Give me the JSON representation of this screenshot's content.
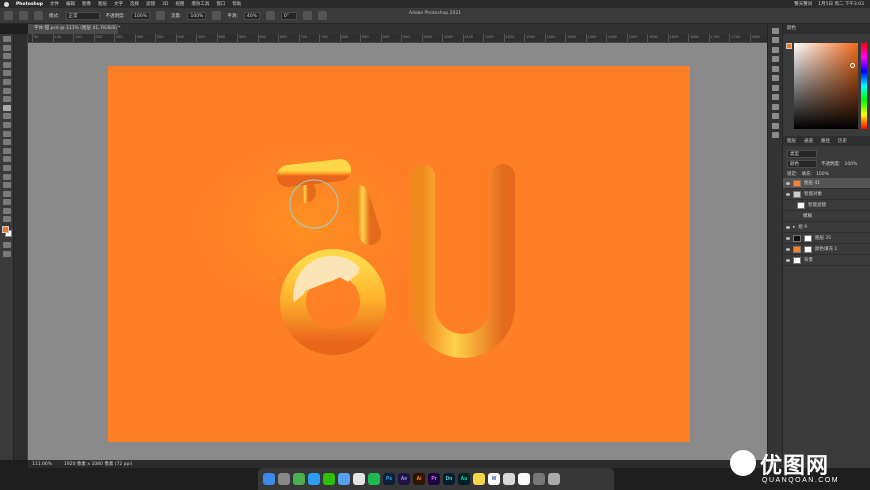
{
  "menubar": {
    "app_name": "Photoshop",
    "items": [
      "文件",
      "编辑",
      "图像",
      "图层",
      "文字",
      "选择",
      "滤镜",
      "3D",
      "视图",
      "增效工具",
      "窗口",
      "帮助"
    ],
    "right_items": [
      "蟹天蟹间",
      "1月5日 周二 下午3:03"
    ]
  },
  "options_bar": {
    "window_title": "Adobe Photoshop 2021",
    "mode_label": "模式:",
    "mode_value": "正常",
    "opacity_label": "不透明度:",
    "opacity_value": "100%",
    "flow_label": "流量:",
    "flow_value": "100%",
    "smoothing_label": "平滑:",
    "smoothing_value": "40%",
    "angle_value": "0°"
  },
  "document": {
    "tab_label": "字体-甜.psd @ 111% (图层 41, RGB/8) *",
    "status_zoom": "111.06%",
    "status_doc": "1920 像素 x 1080 像素 (72 ppi)"
  },
  "ruler": {
    "ticks": [
      "50",
      "100",
      "150",
      "200",
      "250",
      "300",
      "350",
      "400",
      "450",
      "500",
      "550",
      "600",
      "650",
      "700",
      "750",
      "800",
      "850",
      "900",
      "950",
      "1000",
      "1050",
      "1100",
      "1150",
      "1200",
      "1250",
      "1300",
      "1350",
      "1400",
      "1450",
      "1500",
      "1550",
      "1600",
      "1650",
      "1700",
      "1750",
      "1800"
    ]
  },
  "colors": {
    "canvas": "#ff7e26",
    "foreground": "#f57620",
    "background": "#ffffff"
  },
  "panels": {
    "color_tab": "颜色",
    "layers_tabs": [
      "图层",
      "通道",
      "路径",
      "历史"
    ],
    "kind_label": "类型",
    "blend_value": "颜色",
    "opacity_label": "不透明度:",
    "opacity_value": "100%",
    "lock_label": "锁定:",
    "fill_label": "填充:",
    "fill_value": "100%",
    "layers": [
      {
        "name": "图层 41",
        "selected": true
      },
      {
        "name": "智能对象",
        "selected": false
      },
      {
        "name": "智能滤镜",
        "selected": false
      },
      {
        "name": "模糊",
        "selected": false
      },
      {
        "name": "组 9",
        "selected": false
      },
      {
        "name": "图层 35",
        "selected": false
      },
      {
        "name": "颜色填充 1",
        "selected": false
      },
      {
        "name": "背景",
        "selected": false
      }
    ]
  },
  "dock": {
    "apps": [
      "Finder",
      "Launchpad",
      "Chrome",
      "Safari",
      "WeChat",
      "Mail",
      "Music",
      "Spotify",
      "Photoshop",
      "After Effects",
      "Illustrator",
      "Premiere",
      "Dimension",
      "Audition",
      "Notes",
      "Word",
      "Preview",
      "Calendar",
      "System",
      "Trash"
    ],
    "labels": {
      "ps": "Ps",
      "ae": "Ae",
      "ai": "Ai",
      "pr": "Pr",
      "dn": "Dn",
      "au": "Au",
      "w": "W"
    }
  },
  "watermark": {
    "title": "优图网",
    "subtitle": "QUANQOAN.COM"
  }
}
